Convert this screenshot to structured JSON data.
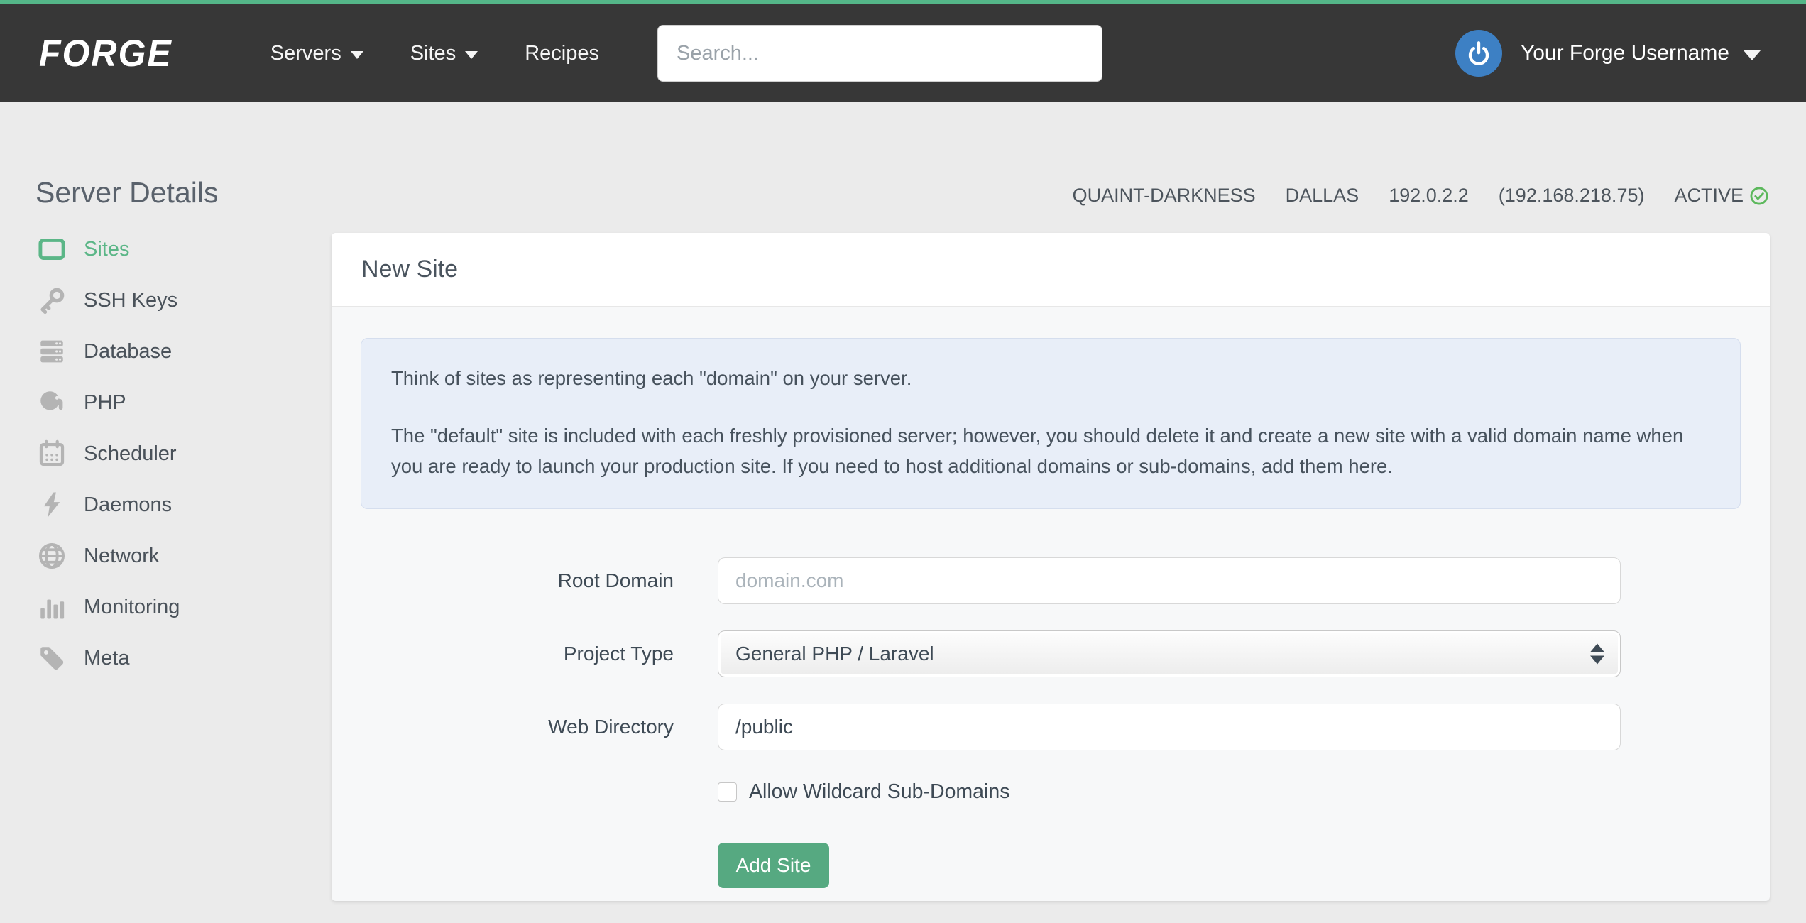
{
  "navbar": {
    "logo": "FORGE",
    "items": [
      {
        "label": "Servers",
        "has_caret": true
      },
      {
        "label": "Sites",
        "has_caret": true
      },
      {
        "label": "Recipes",
        "has_caret": false
      }
    ],
    "search_placeholder": "Search...",
    "user": {
      "name": "Your Forge Username"
    }
  },
  "page": {
    "title": "Server Details",
    "server_meta": {
      "name": "QUAINT-DARKNESS",
      "region": "DALLAS",
      "ip": "192.0.2.2",
      "private_ip": "(192.168.218.75)",
      "status": "ACTIVE"
    }
  },
  "sidebar": {
    "items": [
      {
        "label": "Sites",
        "icon": "window-icon",
        "active": true
      },
      {
        "label": "SSH Keys",
        "icon": "key-icon",
        "active": false
      },
      {
        "label": "Database",
        "icon": "server-stack-icon",
        "active": false
      },
      {
        "label": "PHP",
        "icon": "elephant-icon",
        "active": false
      },
      {
        "label": "Scheduler",
        "icon": "calendar-icon",
        "active": false
      },
      {
        "label": "Daemons",
        "icon": "lightning-icon",
        "active": false
      },
      {
        "label": "Network",
        "icon": "globe-icon",
        "active": false
      },
      {
        "label": "Monitoring",
        "icon": "bar-chart-icon",
        "active": false
      },
      {
        "label": "Meta",
        "icon": "tag-icon",
        "active": false
      }
    ]
  },
  "card": {
    "title": "New Site",
    "alert": {
      "p1": "Think of sites as representing each \"domain\" on your server.",
      "p2": "The \"default\" site is included with each freshly provisioned server; however, you should delete it and create a new site with a valid domain name when you are ready to launch your production site. If you need to host additional domains or sub-domains, add them here."
    },
    "form": {
      "root_domain": {
        "label": "Root Domain",
        "placeholder": "domain.com",
        "value": ""
      },
      "project_type": {
        "label": "Project Type",
        "value": "General PHP / Laravel"
      },
      "web_directory": {
        "label": "Web Directory",
        "value": "/public"
      },
      "wildcard": {
        "label": "Allow Wildcard Sub-Domains",
        "checked": false
      },
      "submit_label": "Add Site"
    }
  },
  "colors": {
    "brand_green": "#54b688",
    "button_green": "#56a981",
    "navbar_bg": "#373737",
    "page_bg": "#ebebeb",
    "alert_bg": "#e8eef8",
    "status_check_green": "#5cb85c",
    "avatar_blue": "#3d80c4"
  }
}
